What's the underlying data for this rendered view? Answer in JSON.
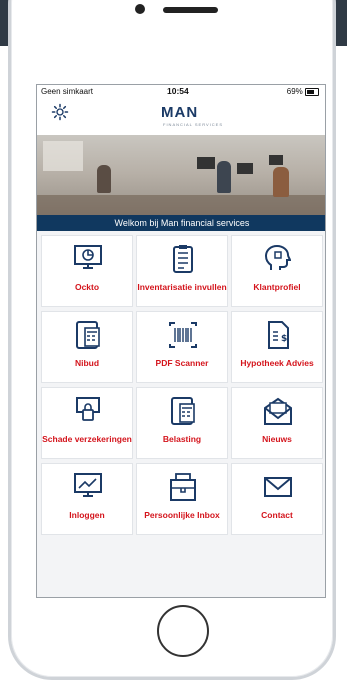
{
  "status_bar": {
    "carrier": "Geen simkaart",
    "time": "10:54",
    "battery": "69%"
  },
  "header": {
    "logo_text": "MAN",
    "logo_subtext": "FINANCIAL SERVICES"
  },
  "hero": {
    "banner_text": "Welkom bij Man financial services"
  },
  "tiles": [
    {
      "label": "Ockto",
      "icon": "monitor-chart-icon"
    },
    {
      "label": "Inventarisatie invullen",
      "icon": "clipboard-list-icon"
    },
    {
      "label": "Klantprofiel",
      "icon": "head-puzzle-icon"
    },
    {
      "label": "Nibud",
      "icon": "calculator-money-icon"
    },
    {
      "label": "PDF Scanner",
      "icon": "barcode-scanner-icon"
    },
    {
      "label": "Hypotheek Advies",
      "icon": "document-dollar-icon"
    },
    {
      "label": "Schade verzekeringen",
      "icon": "lock-shield-icon"
    },
    {
      "label": "Belasting",
      "icon": "calculator-money-icon"
    },
    {
      "label": "Nieuws",
      "icon": "envelope-letter-icon"
    },
    {
      "label": "Inloggen",
      "icon": "monitor-login-icon"
    },
    {
      "label": "Persoonlijke Inbox",
      "icon": "inbox-tray-icon"
    },
    {
      "label": "Contact",
      "icon": "envelope-icon"
    }
  ],
  "colors": {
    "brand_navy": "#10385f",
    "tile_label_red": "#d4141c",
    "icon_blue": "#1b3a66"
  }
}
